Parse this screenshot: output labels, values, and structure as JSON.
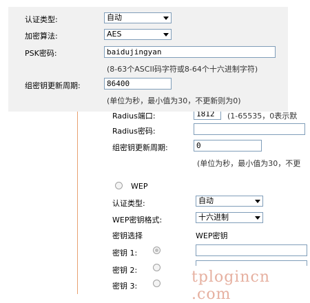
{
  "overlay": {
    "auth_type_label": "认证类型:",
    "auth_type_value": "自动",
    "encryption_label": "加密算法:",
    "encryption_value": "AES",
    "psk_label": "PSK密码:",
    "psk_value": "baidujingyan",
    "psk_hint": "(8-63个ASCII码字符或8-64个十六进制字符)",
    "group_key_label": "组密钥更新周期:",
    "group_key_value": "86400",
    "group_key_hint": "(单位为秒，最小值为30，不更新则为0)"
  },
  "background": {
    "radius_port_label": "Radius端口:",
    "radius_port_value": "1812",
    "radius_port_hint": "(1-65535，0表示默",
    "radius_password_label": "Radius密码:",
    "radius_password_value": "",
    "group_key_label": "组密钥更新周期:",
    "group_key_value": "0",
    "group_key_hint": "(单位为秒，最小值为30，不更",
    "wep_label": "WEP",
    "auth_type_label": "认证类型:",
    "auth_type_value": "自动",
    "wep_format_label": "WEP密钥格式:",
    "wep_format_value": "十六进制",
    "key_select_label": "密钥选择",
    "wep_key_header": "WEP密钥",
    "key1_label": "密钥 1:",
    "key2_label": "密钥 2:",
    "key3_label": "密钥 3:"
  },
  "watermark": "tplogincn .com",
  "colors": {
    "divider": "#e8a070",
    "input_border": "#7f9db9",
    "overlay_bg": "#f1f1f1"
  }
}
